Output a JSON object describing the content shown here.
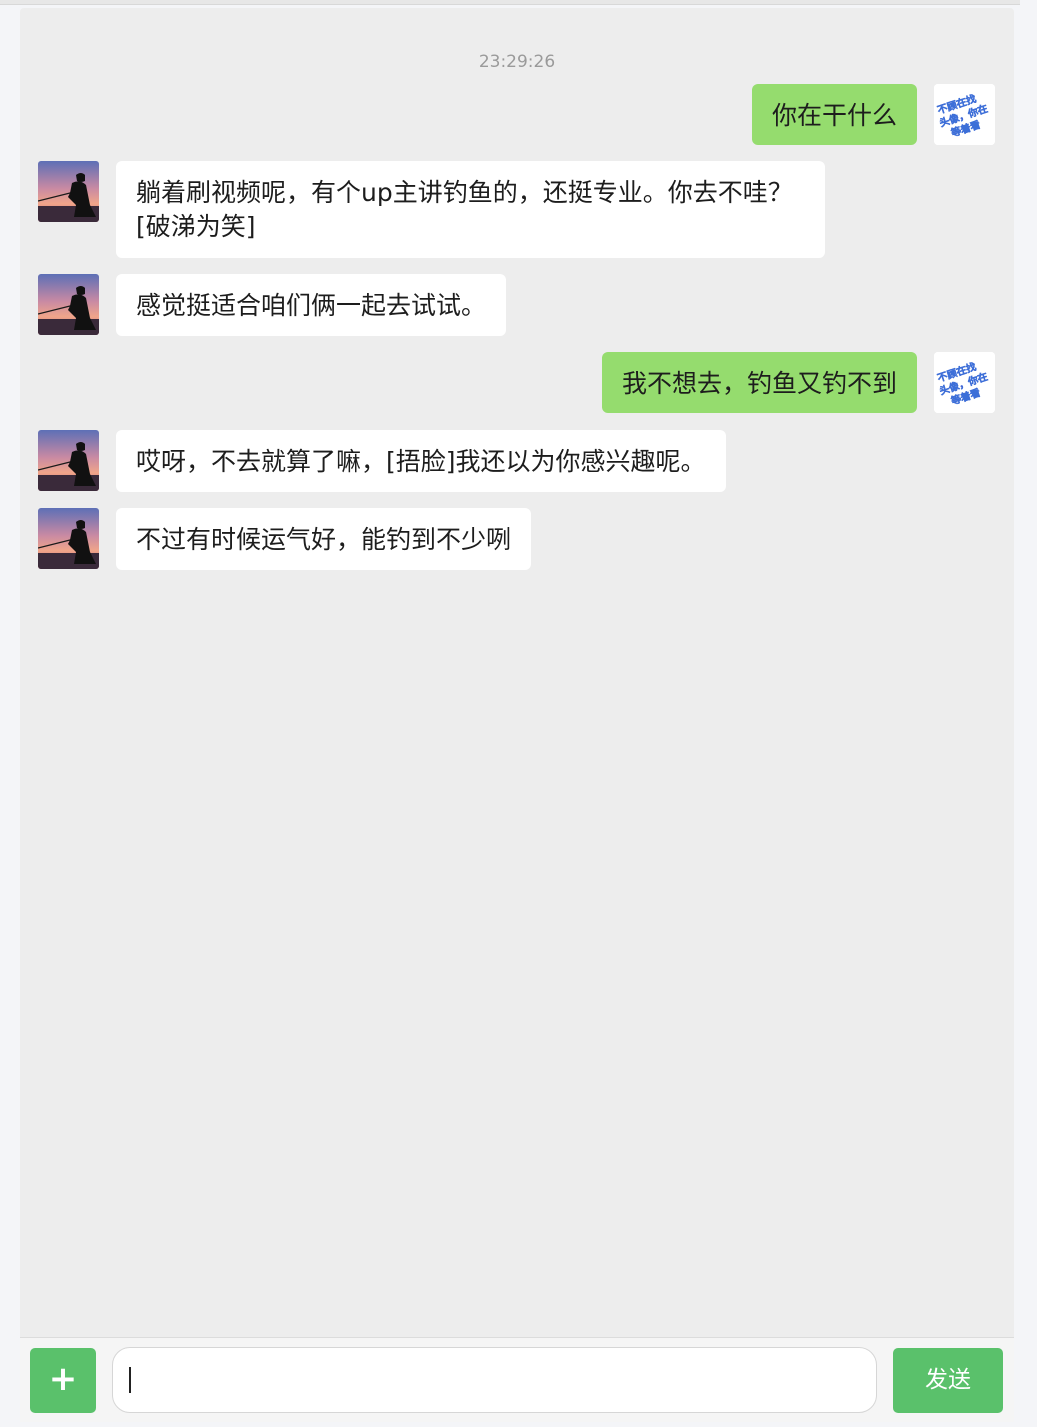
{
  "chat": {
    "timestamp": "23:29:26",
    "messages": [
      {
        "side": "right",
        "text": "你在干什么"
      },
      {
        "side": "left",
        "text": "躺着刷视频呢，有个up主讲钓鱼的，还挺专业。你去不哇？[破涕为笑]"
      },
      {
        "side": "left",
        "text": "感觉挺适合咱们俩一起去试试。"
      },
      {
        "side": "right",
        "text": "我不想去，钓鱼又钓不到"
      },
      {
        "side": "left",
        "text": "哎呀，不去就算了嘛，[捂脸]我还以为你感兴趣呢。"
      },
      {
        "side": "left",
        "text": "不过有时候运气好，能钓到不少咧"
      }
    ]
  },
  "self_avatar": {
    "icon": "sticker-avatar-icon",
    "lines": [
      "不顾在找",
      "头像，你在",
      "等着看"
    ]
  },
  "contact_avatar": {
    "icon": "fisherman-sunset-avatar-icon"
  },
  "input_bar": {
    "plus_label": "+",
    "input_value": "",
    "input_placeholder": "",
    "send_label": "发送"
  },
  "colors": {
    "background": "#ededed",
    "self_bubble": "#95dc6e",
    "other_bubble": "#ffffff",
    "button": "#5ac16b"
  }
}
